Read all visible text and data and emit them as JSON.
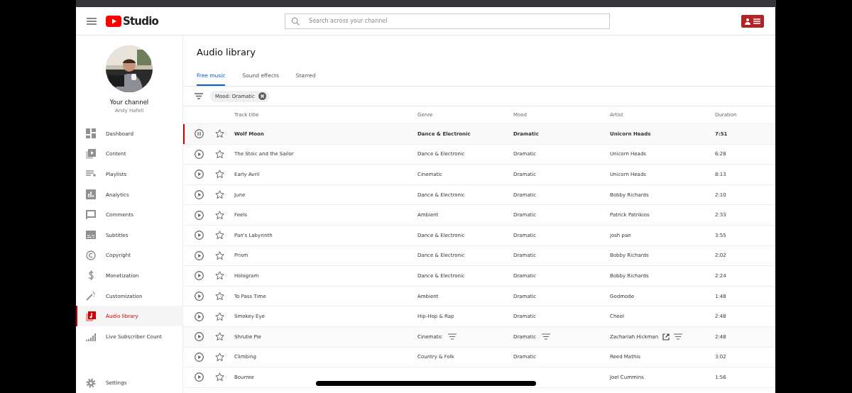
{
  "header": {
    "logo_text": "Studio",
    "search": {
      "placeholder": "Search across your channel"
    }
  },
  "sidebar": {
    "channel_label": "Your channel",
    "channel_name": "Andy Hafell",
    "items": [
      {
        "label": "Dashboard",
        "selected": false
      },
      {
        "label": "Content",
        "selected": false
      },
      {
        "label": "Playlists",
        "selected": false
      },
      {
        "label": "Analytics",
        "selected": false
      },
      {
        "label": "Comments",
        "selected": false
      },
      {
        "label": "Subtitles",
        "selected": false
      },
      {
        "label": "Copyright",
        "selected": false
      },
      {
        "label": "Monetization",
        "selected": false
      },
      {
        "label": "Customization",
        "selected": false
      },
      {
        "label": "Audio library",
        "selected": true
      },
      {
        "label": "Live Subscriber Count",
        "selected": false
      }
    ],
    "settings": "Settings"
  },
  "page": {
    "title": "Audio library",
    "tabs": [
      {
        "label": "Free music",
        "selected": true
      },
      {
        "label": "Sound effects",
        "selected": false
      },
      {
        "label": "Starred",
        "selected": false
      }
    ],
    "filter_chip": "Mood: Dramatic"
  },
  "table": {
    "columns": [
      "Track title",
      "Genre",
      "Mood",
      "Artist",
      "Duration"
    ],
    "rows": [
      {
        "title": "Wolf Moon",
        "genre": "Dance & Electronic",
        "mood": "Dramatic",
        "artist": "Unicorn Heads",
        "duration": "7:51",
        "playing": true,
        "starred": false,
        "hovered": false
      },
      {
        "title": "The Stoic and the Sailor",
        "genre": "Dance & Electronic",
        "mood": "Dramatic",
        "artist": "Unicorn Heads",
        "duration": "6:28",
        "playing": false,
        "starred": false,
        "hovered": false
      },
      {
        "title": "Early Avril",
        "genre": "Cinematic",
        "mood": "Dramatic",
        "artist": "Unicorn Heads",
        "duration": "8:13",
        "playing": false,
        "starred": false,
        "hovered": false
      },
      {
        "title": "June",
        "genre": "Dance & Electronic",
        "mood": "Dramatic",
        "artist": "Bobby Richards",
        "duration": "2:10",
        "playing": false,
        "starred": false,
        "hovered": false
      },
      {
        "title": "Feels",
        "genre": "Ambient",
        "mood": "Dramatic",
        "artist": "Patrick Patrikios",
        "duration": "2:33",
        "playing": false,
        "starred": false,
        "hovered": false
      },
      {
        "title": "Pan's Labyrinth",
        "genre": "Dance & Electronic",
        "mood": "Dramatic",
        "artist": "josh pan",
        "duration": "3:55",
        "playing": false,
        "starred": false,
        "hovered": false
      },
      {
        "title": "Prism",
        "genre": "Dance & Electronic",
        "mood": "Dramatic",
        "artist": "Bobby Richards",
        "duration": "2:02",
        "playing": false,
        "starred": false,
        "hovered": false
      },
      {
        "title": "Hologram",
        "genre": "Dance & Electronic",
        "mood": "Dramatic",
        "artist": "Bobby Richards",
        "duration": "2:24",
        "playing": false,
        "starred": false,
        "hovered": false
      },
      {
        "title": "To Pass Time",
        "genre": "Ambient",
        "mood": "Dramatic",
        "artist": "Godmode",
        "duration": "1:48",
        "playing": false,
        "starred": false,
        "hovered": false
      },
      {
        "title": "Smokey Eye",
        "genre": "Hip-Hop & Rap",
        "mood": "Dramatic",
        "artist": "Cheel",
        "duration": "2:48",
        "playing": false,
        "starred": false,
        "hovered": false
      },
      {
        "title": "Shrutie Pie",
        "genre": "Cinematic",
        "mood": "Dramatic",
        "artist": "Zachariah Hickman",
        "duration": "2:48",
        "playing": false,
        "starred": false,
        "hovered": true
      },
      {
        "title": "Climbing",
        "genre": "Country & Folk",
        "mood": "Dramatic",
        "artist": "Reed Mathis",
        "duration": "3:02",
        "playing": false,
        "starred": false,
        "hovered": false
      },
      {
        "title": "Bourree",
        "artist": "Joel Cummins",
        "duration": "1:56",
        "playing": false,
        "starred": false,
        "hovered": false
      }
    ]
  }
}
